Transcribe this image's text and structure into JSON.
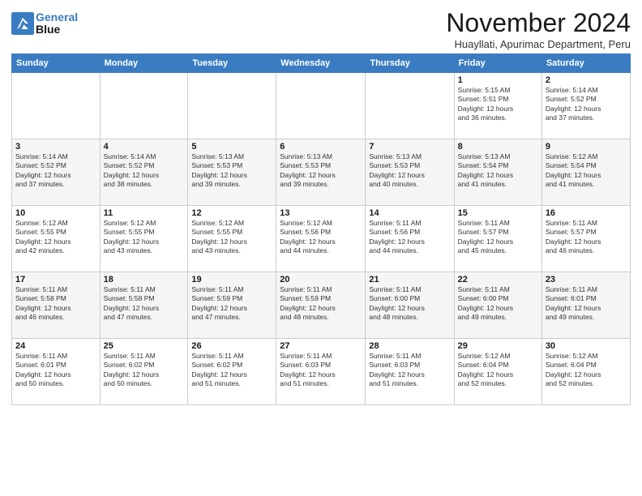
{
  "header": {
    "logo_line1": "General",
    "logo_line2": "Blue",
    "month_title": "November 2024",
    "subtitle": "Huayllati, Apurimac Department, Peru"
  },
  "days_of_week": [
    "Sunday",
    "Monday",
    "Tuesday",
    "Wednesday",
    "Thursday",
    "Friday",
    "Saturday"
  ],
  "weeks": [
    [
      {
        "day": "",
        "info": ""
      },
      {
        "day": "",
        "info": ""
      },
      {
        "day": "",
        "info": ""
      },
      {
        "day": "",
        "info": ""
      },
      {
        "day": "",
        "info": ""
      },
      {
        "day": "1",
        "info": "Sunrise: 5:15 AM\nSunset: 5:51 PM\nDaylight: 12 hours\nand 36 minutes."
      },
      {
        "day": "2",
        "info": "Sunrise: 5:14 AM\nSunset: 5:52 PM\nDaylight: 12 hours\nand 37 minutes."
      }
    ],
    [
      {
        "day": "3",
        "info": "Sunrise: 5:14 AM\nSunset: 5:52 PM\nDaylight: 12 hours\nand 37 minutes."
      },
      {
        "day": "4",
        "info": "Sunrise: 5:14 AM\nSunset: 5:52 PM\nDaylight: 12 hours\nand 38 minutes."
      },
      {
        "day": "5",
        "info": "Sunrise: 5:13 AM\nSunset: 5:53 PM\nDaylight: 12 hours\nand 39 minutes."
      },
      {
        "day": "6",
        "info": "Sunrise: 5:13 AM\nSunset: 5:53 PM\nDaylight: 12 hours\nand 39 minutes."
      },
      {
        "day": "7",
        "info": "Sunrise: 5:13 AM\nSunset: 5:53 PM\nDaylight: 12 hours\nand 40 minutes."
      },
      {
        "day": "8",
        "info": "Sunrise: 5:13 AM\nSunset: 5:54 PM\nDaylight: 12 hours\nand 41 minutes."
      },
      {
        "day": "9",
        "info": "Sunrise: 5:12 AM\nSunset: 5:54 PM\nDaylight: 12 hours\nand 41 minutes."
      }
    ],
    [
      {
        "day": "10",
        "info": "Sunrise: 5:12 AM\nSunset: 5:55 PM\nDaylight: 12 hours\nand 42 minutes."
      },
      {
        "day": "11",
        "info": "Sunrise: 5:12 AM\nSunset: 5:55 PM\nDaylight: 12 hours\nand 43 minutes."
      },
      {
        "day": "12",
        "info": "Sunrise: 5:12 AM\nSunset: 5:55 PM\nDaylight: 12 hours\nand 43 minutes."
      },
      {
        "day": "13",
        "info": "Sunrise: 5:12 AM\nSunset: 5:56 PM\nDaylight: 12 hours\nand 44 minutes."
      },
      {
        "day": "14",
        "info": "Sunrise: 5:11 AM\nSunset: 5:56 PM\nDaylight: 12 hours\nand 44 minutes."
      },
      {
        "day": "15",
        "info": "Sunrise: 5:11 AM\nSunset: 5:57 PM\nDaylight: 12 hours\nand 45 minutes."
      },
      {
        "day": "16",
        "info": "Sunrise: 5:11 AM\nSunset: 5:57 PM\nDaylight: 12 hours\nand 46 minutes."
      }
    ],
    [
      {
        "day": "17",
        "info": "Sunrise: 5:11 AM\nSunset: 5:58 PM\nDaylight: 12 hours\nand 46 minutes."
      },
      {
        "day": "18",
        "info": "Sunrise: 5:11 AM\nSunset: 5:58 PM\nDaylight: 12 hours\nand 47 minutes."
      },
      {
        "day": "19",
        "info": "Sunrise: 5:11 AM\nSunset: 5:59 PM\nDaylight: 12 hours\nand 47 minutes."
      },
      {
        "day": "20",
        "info": "Sunrise: 5:11 AM\nSunset: 5:59 PM\nDaylight: 12 hours\nand 48 minutes."
      },
      {
        "day": "21",
        "info": "Sunrise: 5:11 AM\nSunset: 6:00 PM\nDaylight: 12 hours\nand 48 minutes."
      },
      {
        "day": "22",
        "info": "Sunrise: 5:11 AM\nSunset: 6:00 PM\nDaylight: 12 hours\nand 49 minutes."
      },
      {
        "day": "23",
        "info": "Sunrise: 5:11 AM\nSunset: 6:01 PM\nDaylight: 12 hours\nand 49 minutes."
      }
    ],
    [
      {
        "day": "24",
        "info": "Sunrise: 5:11 AM\nSunset: 6:01 PM\nDaylight: 12 hours\nand 50 minutes."
      },
      {
        "day": "25",
        "info": "Sunrise: 5:11 AM\nSunset: 6:02 PM\nDaylight: 12 hours\nand 50 minutes."
      },
      {
        "day": "26",
        "info": "Sunrise: 5:11 AM\nSunset: 6:02 PM\nDaylight: 12 hours\nand 51 minutes."
      },
      {
        "day": "27",
        "info": "Sunrise: 5:11 AM\nSunset: 6:03 PM\nDaylight: 12 hours\nand 51 minutes."
      },
      {
        "day": "28",
        "info": "Sunrise: 5:11 AM\nSunset: 6:03 PM\nDaylight: 12 hours\nand 51 minutes."
      },
      {
        "day": "29",
        "info": "Sunrise: 5:12 AM\nSunset: 6:04 PM\nDaylight: 12 hours\nand 52 minutes."
      },
      {
        "day": "30",
        "info": "Sunrise: 5:12 AM\nSunset: 6:04 PM\nDaylight: 12 hours\nand 52 minutes."
      }
    ]
  ]
}
